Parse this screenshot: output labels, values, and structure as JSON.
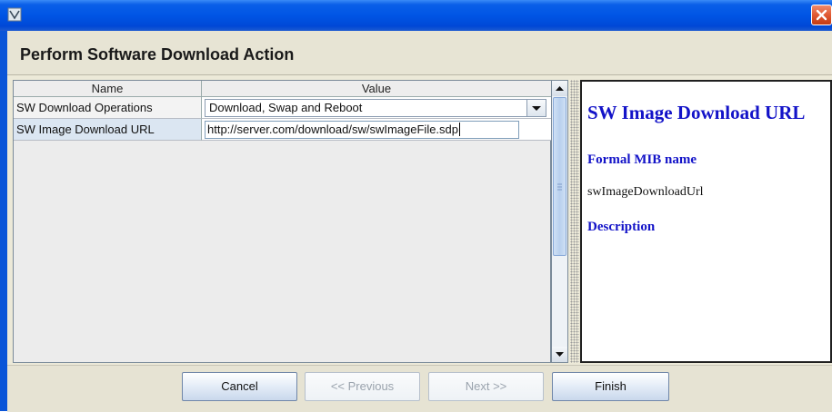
{
  "window": {
    "title": "",
    "icon": "app-icon",
    "close_icon": "close-icon"
  },
  "header": {
    "title": "Perform Software Download Action"
  },
  "table": {
    "columns": [
      "Name",
      "Value"
    ],
    "rows": [
      {
        "name": "SW Download Operations",
        "value": "Download, Swap and Reboot",
        "type": "combo"
      },
      {
        "name": "SW Image Download URL",
        "value": "http://server.com/download/sw/swImageFile.sdp",
        "type": "text"
      }
    ]
  },
  "help": {
    "title": "SW Image Download URL",
    "formal_label": "Formal MIB name",
    "formal_value": "swImageDownloadUrl",
    "description_label": "Description"
  },
  "buttons": {
    "cancel": "Cancel",
    "previous": "<< Previous",
    "next": "Next >>",
    "finish": "Finish"
  },
  "colors": {
    "titlebar": "#0055e5",
    "help_heading": "#1313c8",
    "selected_row": "#dbe6f2"
  }
}
